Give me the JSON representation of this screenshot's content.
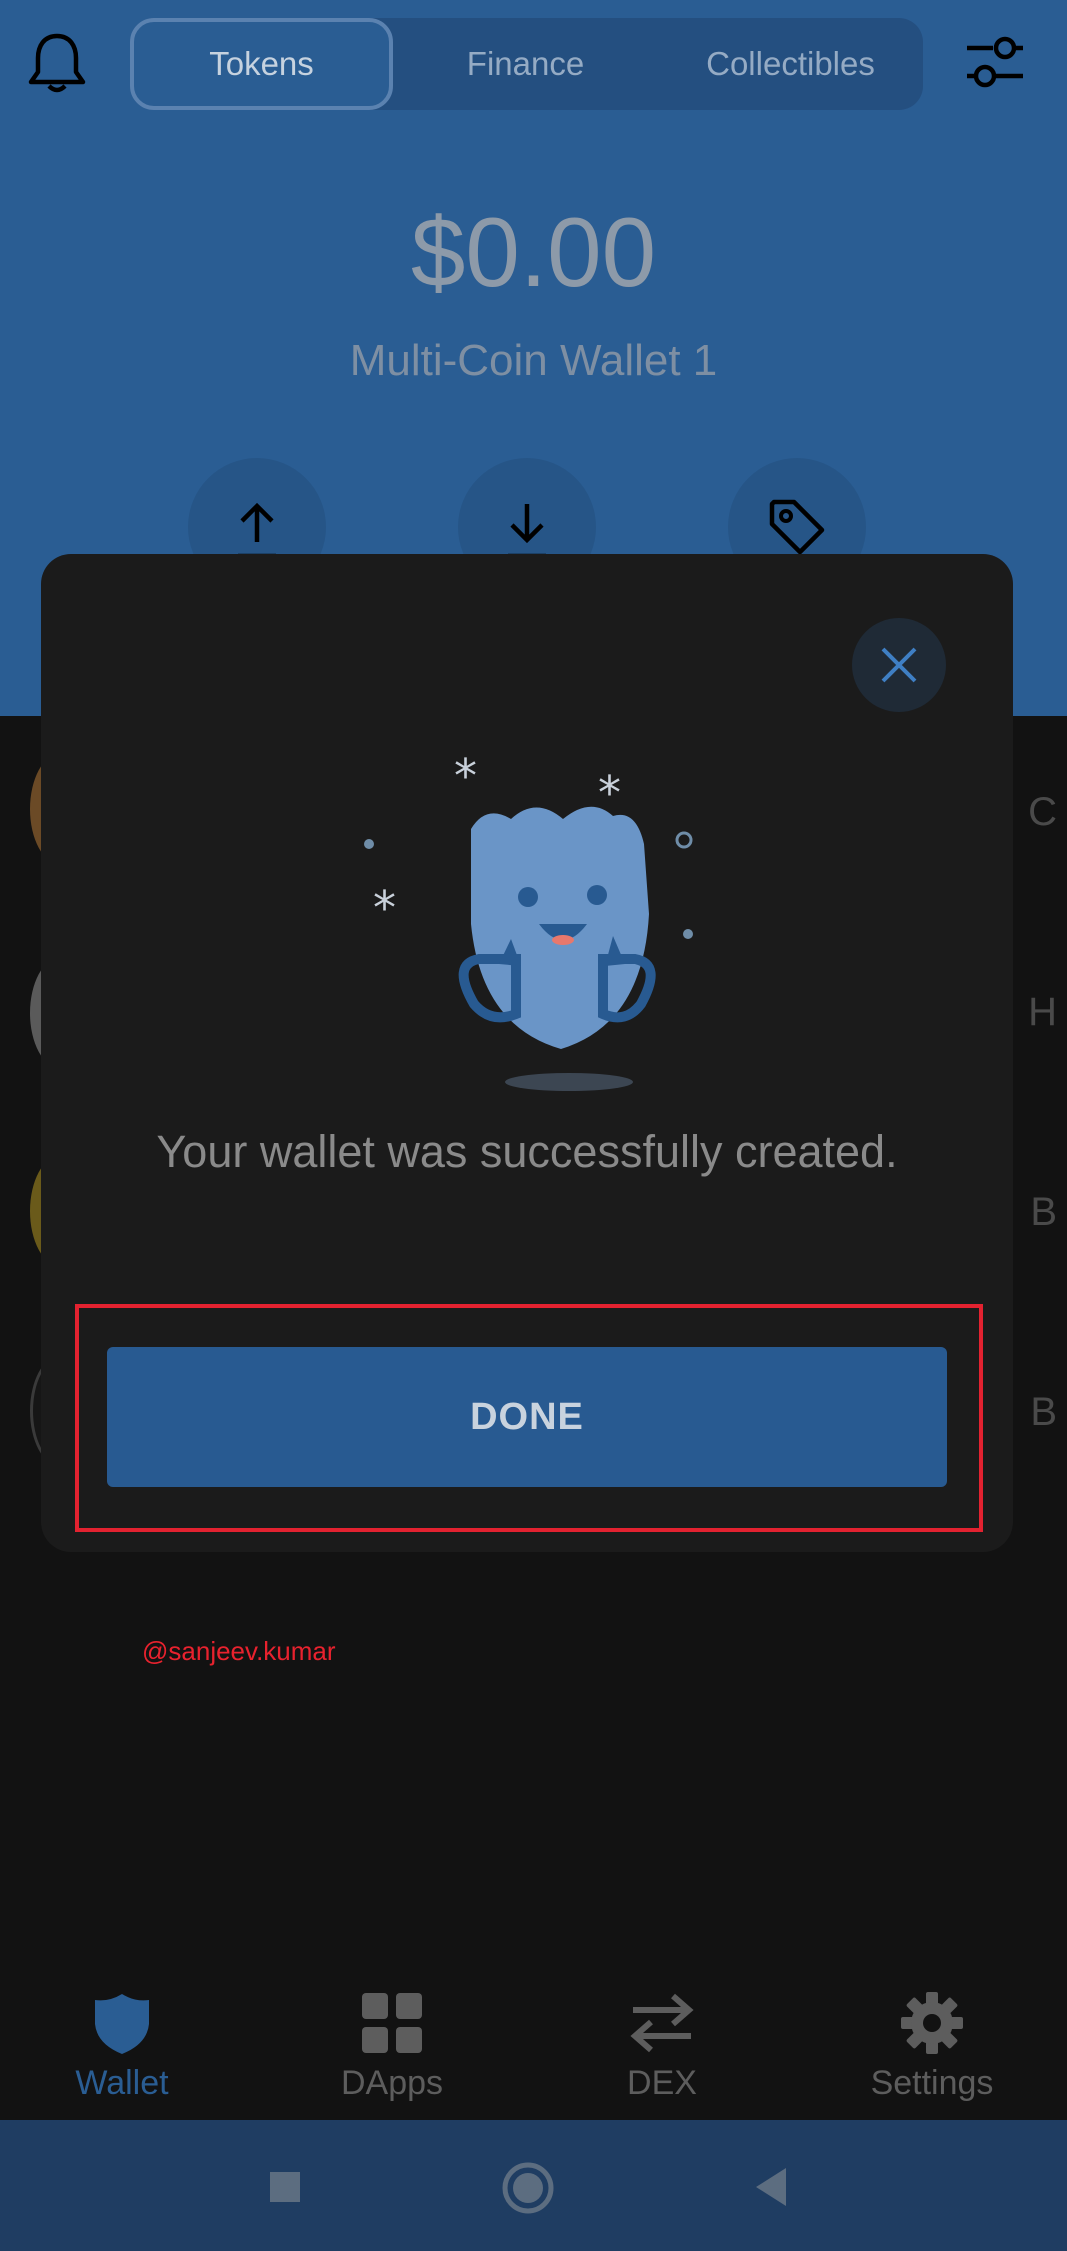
{
  "header": {
    "tabs": [
      {
        "label": "Tokens",
        "active": true
      },
      {
        "label": "Finance",
        "active": false
      },
      {
        "label": "Collectibles",
        "active": false
      }
    ],
    "balance": "$0.00",
    "wallet_name": "Multi-Coin Wallet 1",
    "actions": [
      "send-icon",
      "receive-icon",
      "buy-icon"
    ]
  },
  "modal": {
    "message": "Your wallet was successfully created.",
    "done_label": "DONE"
  },
  "watermark": "@sanjeev.kumar",
  "nav": {
    "items": [
      {
        "label": "Wallet",
        "icon": "shield-icon",
        "active": true
      },
      {
        "label": "DApps",
        "icon": "grid-icon",
        "active": false
      },
      {
        "label": "DEX",
        "icon": "swap-icon",
        "active": false
      },
      {
        "label": "Settings",
        "icon": "gear-icon",
        "active": false
      }
    ]
  },
  "colors": {
    "accent": "#2a5d93",
    "modal_bg": "#1b1b1b",
    "highlight": "#e32230",
    "watermark": "#e8222e"
  }
}
